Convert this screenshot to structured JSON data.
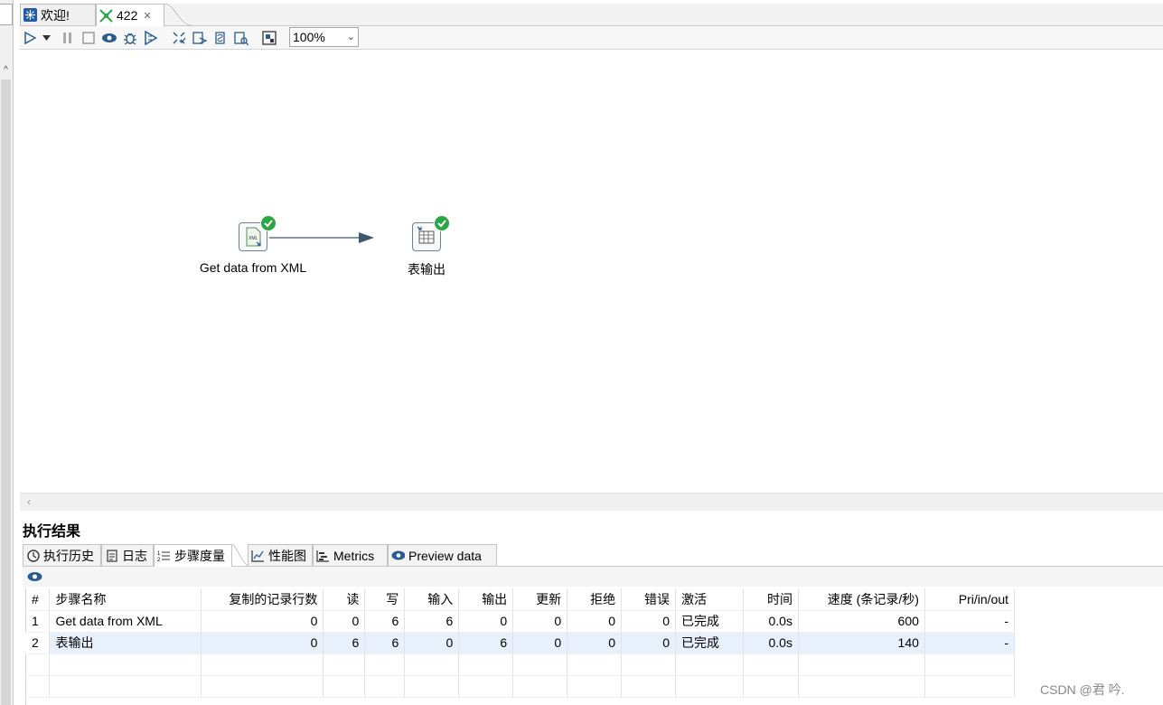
{
  "tabs": [
    {
      "label": "欢迎!",
      "icon": "spoon-icon",
      "active": false
    },
    {
      "label": "422",
      "icon": "transformation-icon",
      "active": true,
      "closable": true
    }
  ],
  "toolbar": {
    "zoom": "100%"
  },
  "canvas": {
    "steps": [
      {
        "name": "Get data from XML",
        "icon": "xml-file-icon",
        "status": "success"
      },
      {
        "name": "表输出",
        "icon": "table-output-icon",
        "status": "success"
      }
    ],
    "hop": {
      "from": "Get data from XML",
      "to": "表输出"
    }
  },
  "results": {
    "title": "执行结果",
    "tabs": [
      {
        "label": "执行历史",
        "icon": "history-icon"
      },
      {
        "label": "日志",
        "icon": "log-icon"
      },
      {
        "label": "步骤度量",
        "icon": "step-metrics-icon",
        "active": true
      },
      {
        "label": "性能图",
        "icon": "perf-graph-icon"
      },
      {
        "label": "Metrics",
        "icon": "metrics-icon"
      },
      {
        "label": "Preview data",
        "icon": "preview-eye-icon"
      }
    ],
    "columns": [
      "#",
      "步骤名称",
      "复制的记录行数",
      "读",
      "写",
      "输入",
      "输出",
      "更新",
      "拒绝",
      "错误",
      "激活",
      "时间",
      "速度 (条记录/秒)",
      "Pri/in/out"
    ],
    "rows": [
      [
        "1",
        "Get data from XML",
        "0",
        "0",
        "6",
        "6",
        "0",
        "0",
        "0",
        "0",
        "已完成",
        "0.0s",
        "600",
        "-"
      ],
      [
        "2",
        "表输出",
        "0",
        "6",
        "6",
        "0",
        "6",
        "0",
        "0",
        "0",
        "已完成",
        "0.0s",
        "140",
        "-"
      ]
    ]
  },
  "watermark": "CSDN @君    吟."
}
